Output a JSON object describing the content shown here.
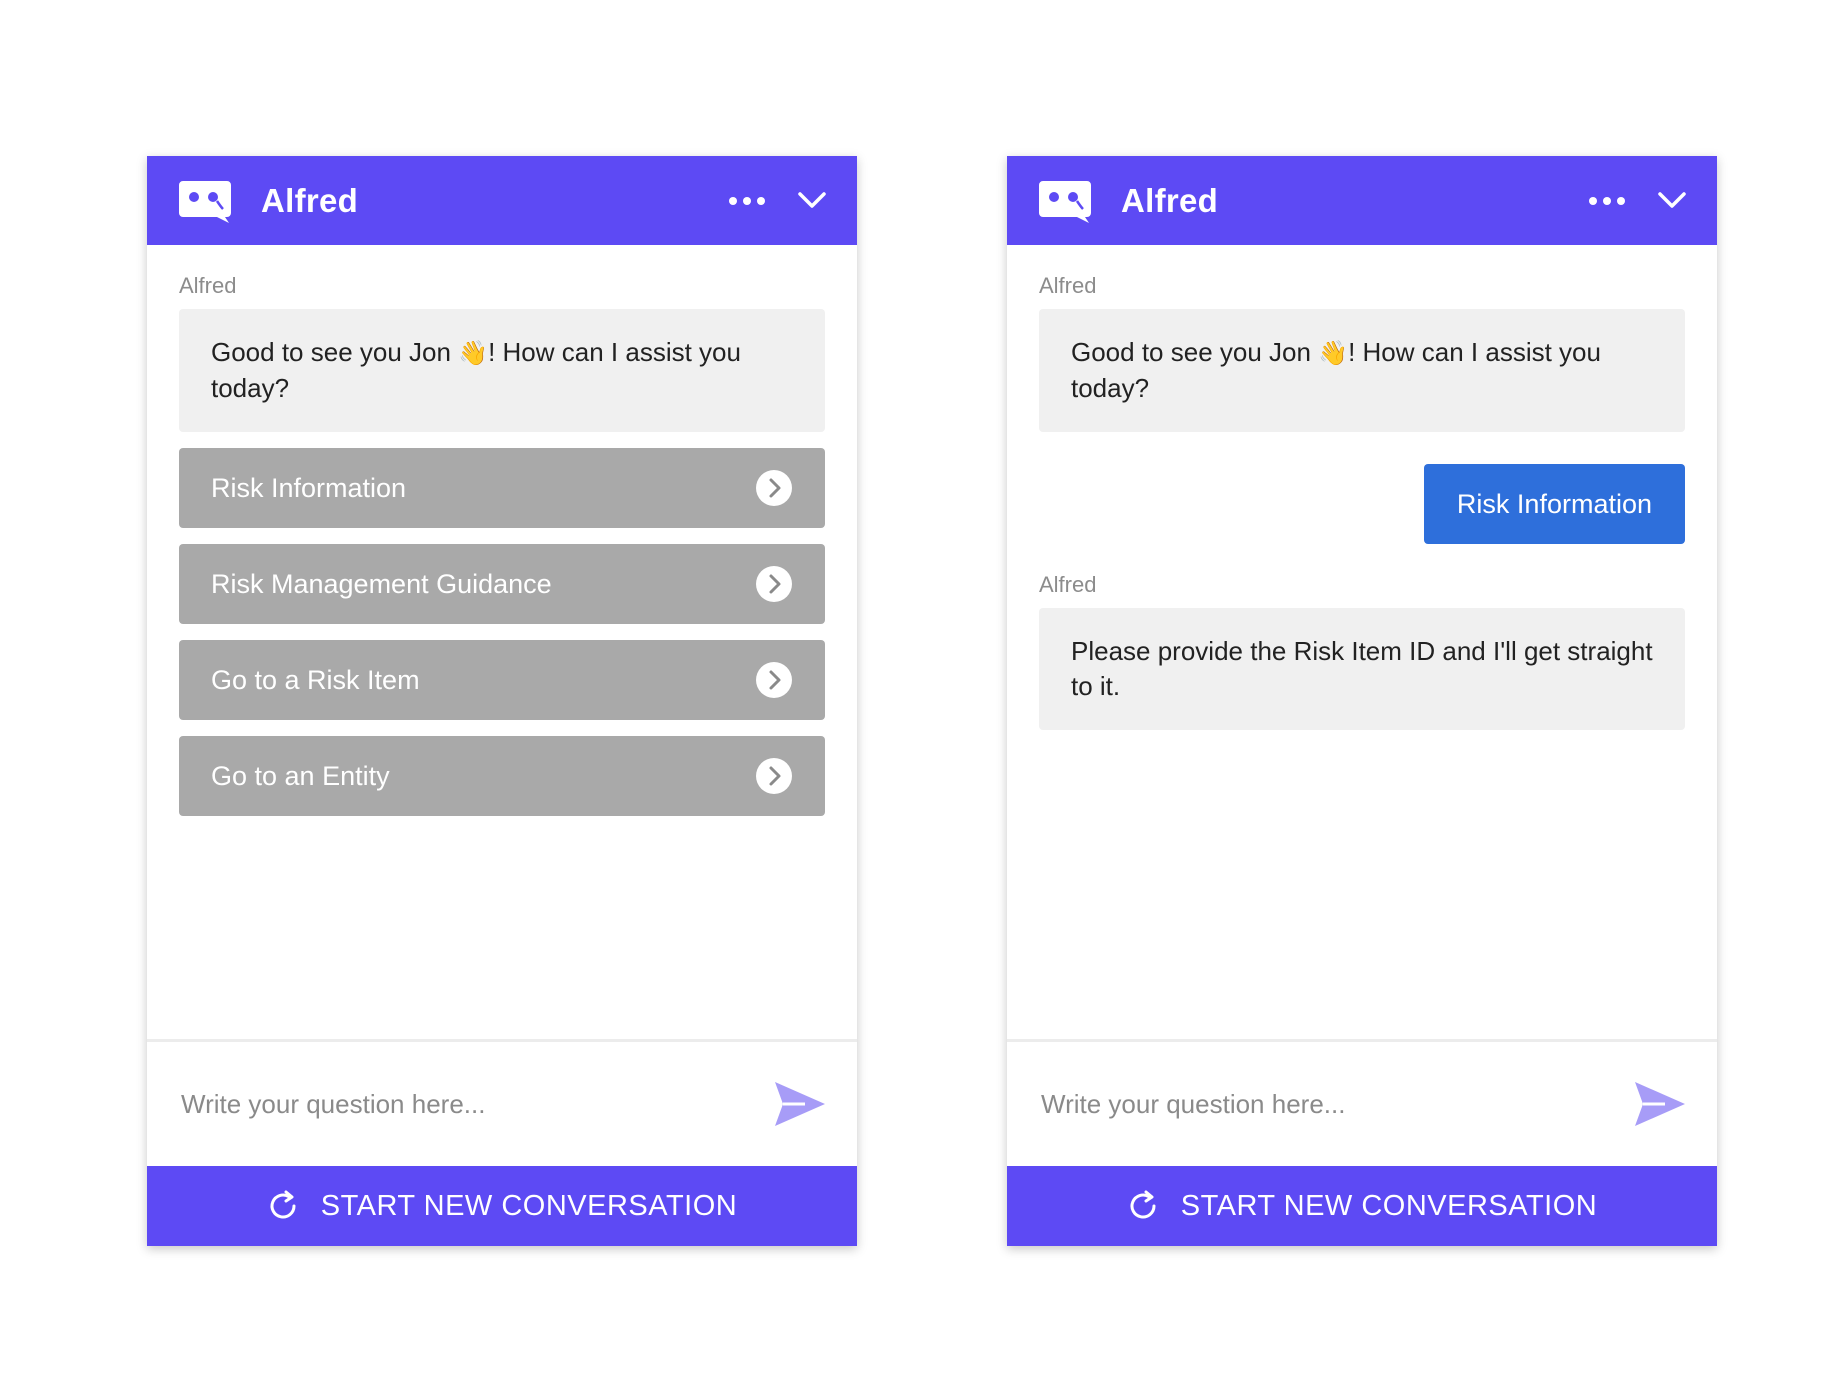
{
  "theme": {
    "brand": "#5d4af4",
    "option_bg": "#a9a9a9",
    "user_bubble": "#2e6fdb",
    "bot_bubble": "#f0f0f0",
    "send_icon": "#a79cf7"
  },
  "panels": [
    {
      "header": {
        "title": "Alfred",
        "icons": [
          "chat-bot-icon",
          "more-options-icon",
          "chevron-down-icon"
        ]
      },
      "messages": {
        "sender": "Alfred",
        "greeting_before": "Good to see you Jon",
        "greeting_emoji": "👋",
        "greeting_after": "! How can I assist you today?"
      },
      "options": [
        "Risk Information",
        "Risk Management Guidance",
        "Go to a Risk Item",
        "Go to an Entity"
      ],
      "composer": {
        "placeholder": "Write your question here..."
      },
      "footer": {
        "label": "START NEW CONVERSATION"
      }
    },
    {
      "header": {
        "title": "Alfred",
        "icons": [
          "chat-bot-icon",
          "more-options-icon",
          "chevron-down-icon"
        ]
      },
      "messages": {
        "sender": "Alfred",
        "greeting_before": "Good to see you Jon",
        "greeting_emoji": "👋",
        "greeting_after": "! How can I assist you today?",
        "user_reply": "Risk Information",
        "sender2": "Alfred",
        "reply": "Please provide the Risk Item ID and I'll get straight to it."
      },
      "composer": {
        "placeholder": "Write your question here..."
      },
      "footer": {
        "label": "START NEW CONVERSATION"
      }
    }
  ]
}
